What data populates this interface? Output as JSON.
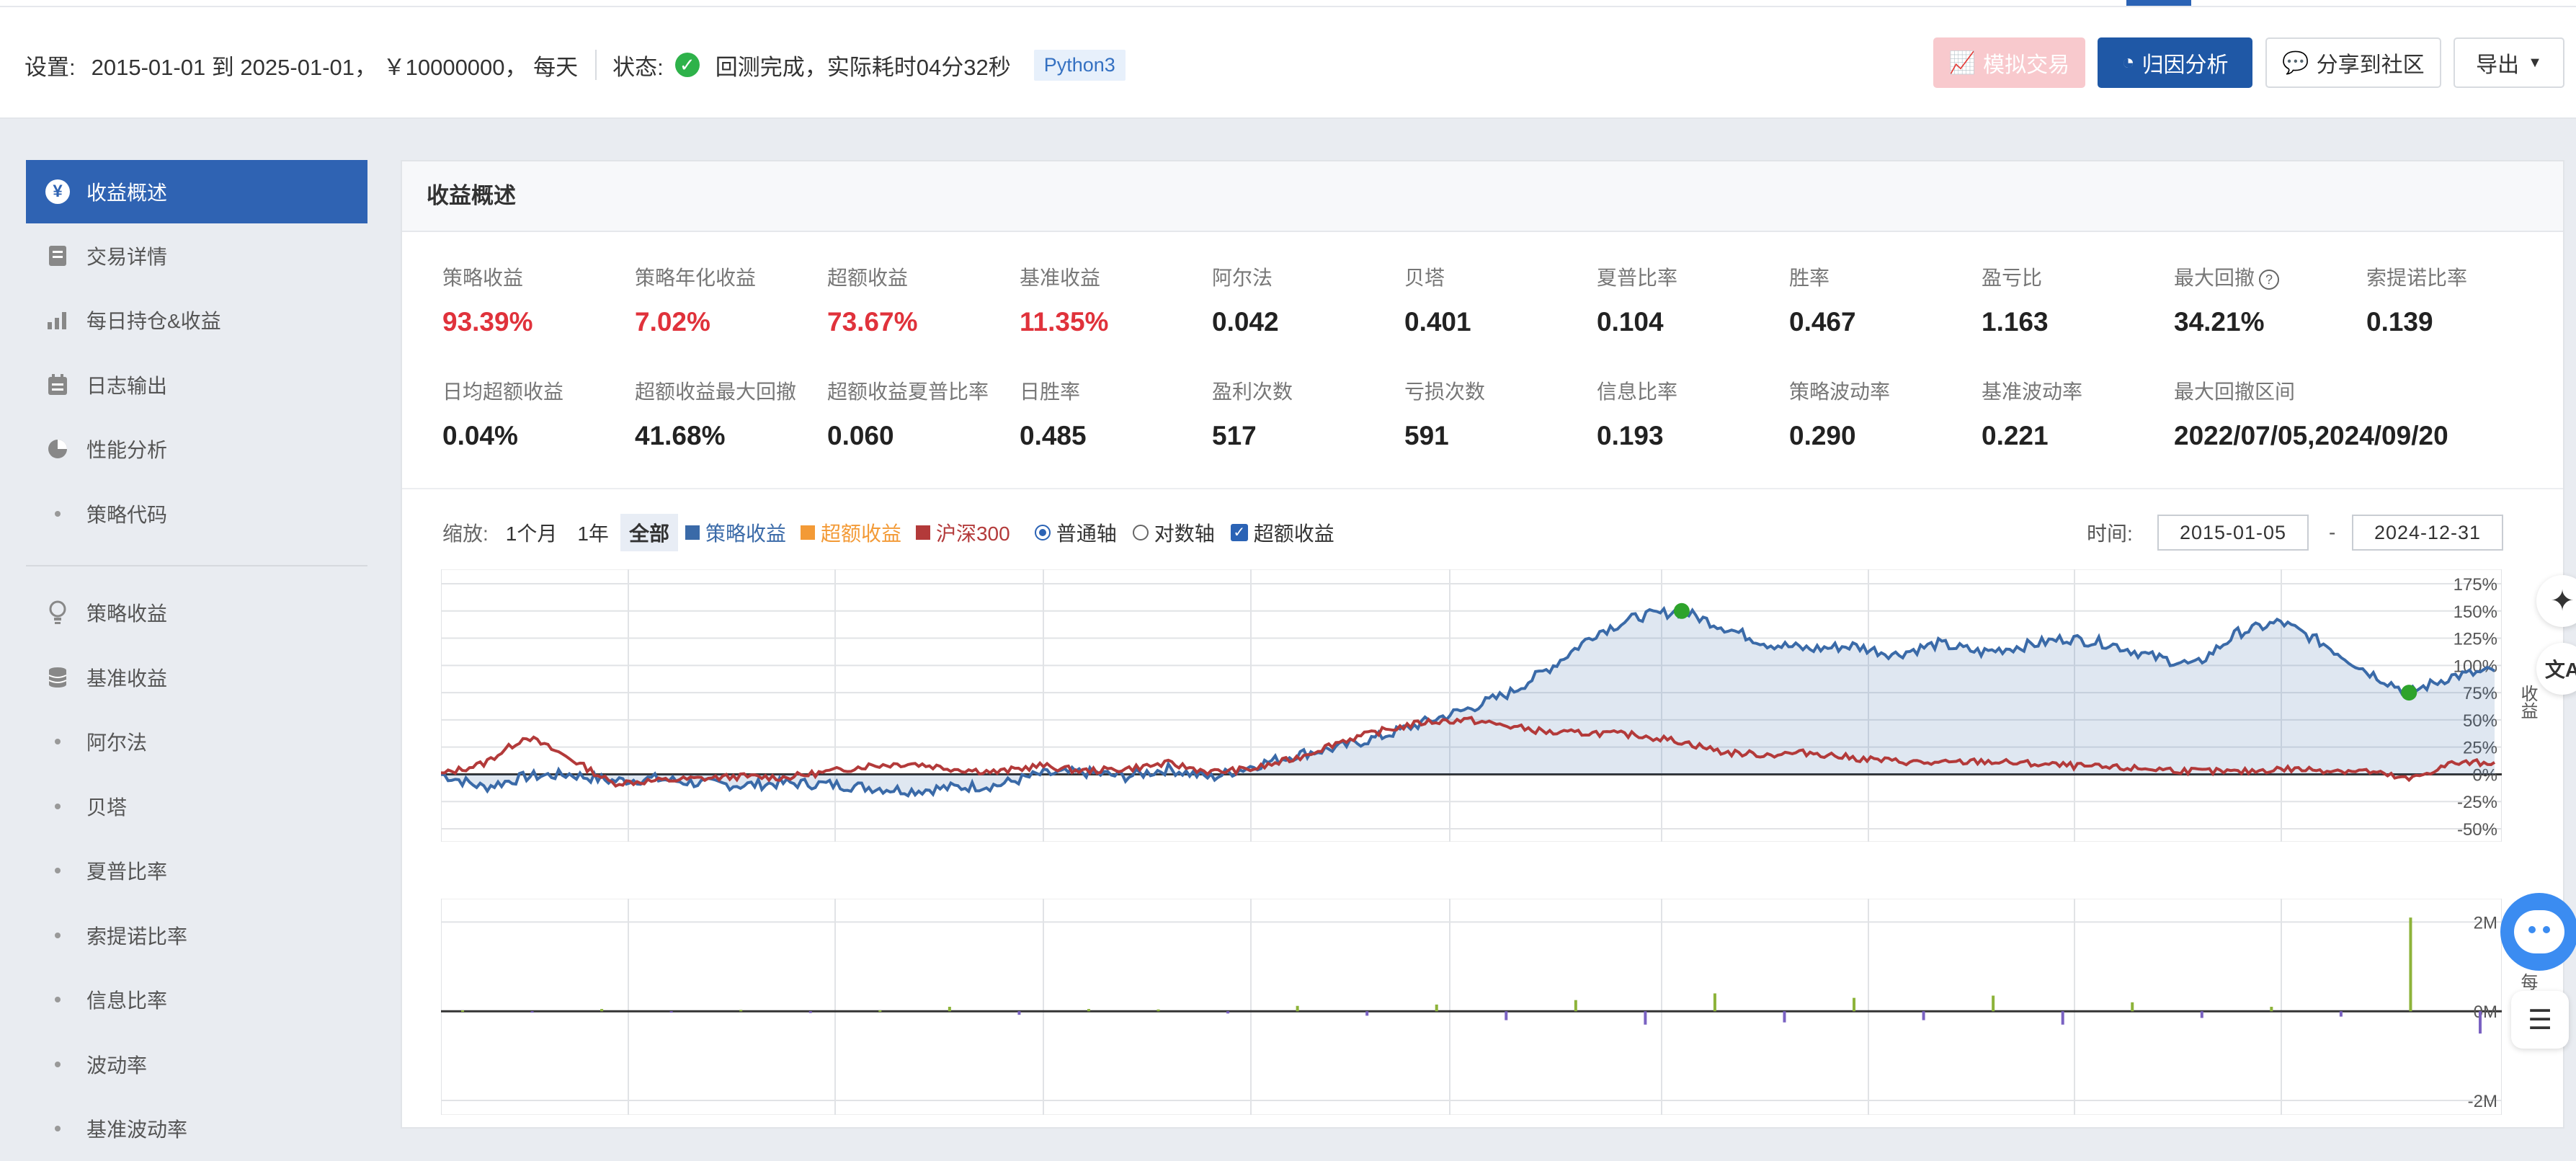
{
  "header": {
    "settings_label": "设置:",
    "settings_value": "2015-01-01 到 2025-01-01， ￥10000000， 每天",
    "status_label": "状态:",
    "status_value": "回测完成，实际耗时04分32秒",
    "language_tag": "Python3",
    "buttons": {
      "simulate": "模拟交易",
      "attribution": "归因分析",
      "share": "分享到社区",
      "export": "导出"
    }
  },
  "sidebar": {
    "items": [
      {
        "label": "收益概述",
        "icon": "yuan-icon",
        "active": true
      },
      {
        "label": "交易详情",
        "icon": "document-icon"
      },
      {
        "label": "每日持仓&收益",
        "icon": "bar-chart-icon"
      },
      {
        "label": "日志输出",
        "icon": "calendar-icon"
      },
      {
        "label": "性能分析",
        "icon": "pie-icon"
      },
      {
        "label": "策略代码",
        "icon": "dot"
      }
    ],
    "analysis_items": [
      {
        "label": "策略收益",
        "icon": "bulb-icon"
      },
      {
        "label": "基准收益",
        "icon": "database-icon"
      },
      {
        "label": "阿尔法",
        "icon": "dot"
      },
      {
        "label": "贝塔",
        "icon": "dot"
      },
      {
        "label": "夏普比率",
        "icon": "dot"
      },
      {
        "label": "索提诺比率",
        "icon": "dot"
      },
      {
        "label": "信息比率",
        "icon": "dot"
      },
      {
        "label": "波动率",
        "icon": "dot"
      },
      {
        "label": "基准波动率",
        "icon": "dot"
      }
    ]
  },
  "panel": {
    "title": "收益概述",
    "stats_row1": [
      {
        "label": "策略收益",
        "value": "93.39%",
        "red": true
      },
      {
        "label": "策略年化收益",
        "value": "7.02%",
        "red": true
      },
      {
        "label": "超额收益",
        "value": "73.67%",
        "red": true
      },
      {
        "label": "基准收益",
        "value": "11.35%",
        "red": true
      },
      {
        "label": "阿尔法",
        "value": "0.042"
      },
      {
        "label": "贝塔",
        "value": "0.401"
      },
      {
        "label": "夏普比率",
        "value": "0.104"
      },
      {
        "label": "胜率",
        "value": "0.467"
      },
      {
        "label": "盈亏比",
        "value": "1.163"
      },
      {
        "label": "最大回撤",
        "value": "34.21%"
      },
      {
        "label": "索提诺比率",
        "value": "0.139"
      }
    ],
    "stats_row2": [
      {
        "label": "日均超额收益",
        "value": "0.04%"
      },
      {
        "label": "超额收益最大回撤",
        "value": "41.68%"
      },
      {
        "label": "超额收益夏普比率",
        "value": "0.060"
      },
      {
        "label": "日胜率",
        "value": "0.485"
      },
      {
        "label": "盈利次数",
        "value": "517"
      },
      {
        "label": "亏损次数",
        "value": "591"
      },
      {
        "label": "信息比率",
        "value": "0.193"
      },
      {
        "label": "策略波动率",
        "value": "0.290"
      },
      {
        "label": "基准波动率",
        "value": "0.221"
      },
      {
        "label": "最大回撤区间",
        "value": "2022/07/05,2024/09/20"
      }
    ]
  },
  "controls": {
    "zoom_label": "缩放:",
    "zoom_options": [
      "1个月",
      "1年",
      "全部"
    ],
    "zoom_selected": "全部",
    "legend": [
      {
        "name": "策略收益",
        "color": "#3a6aa8"
      },
      {
        "name": "超额收益",
        "color": "#f39a36"
      },
      {
        "name": "沪深300",
        "color": "#b33a3a"
      }
    ],
    "axis_normal": "普通轴",
    "axis_log": "对数轴",
    "excess_check": "超额收益",
    "time_label": "时间:",
    "date_from": "2015-01-05",
    "date_to": "2024-12-31",
    "dash": "-"
  },
  "chart_data": [
    {
      "type": "area",
      "title": "",
      "x_range": [
        "2015-01-05",
        "2024-12-31"
      ],
      "ylabel": "收益",
      "y_ticks": [
        "175%",
        "150%",
        "125%",
        "100%",
        "75%",
        "50%",
        "25%",
        "0%",
        "-25%",
        "-50%"
      ],
      "ylim": [
        -50,
        175
      ],
      "series": [
        {
          "name": "策略收益",
          "color": "#3a6aa8",
          "values": [
            0,
            -12,
            -2,
            0,
            -6,
            -4,
            -8,
            -10,
            -8,
            -9,
            -12,
            -15,
            -12,
            -10,
            0,
            2,
            -2,
            5,
            -3,
            8,
            18,
            25,
            35,
            48,
            60,
            75,
            100,
            130,
            145,
            150,
            135,
            120,
            115,
            118,
            110,
            120,
            112,
            118,
            125,
            120,
            108,
            100,
            130,
            140,
            120,
            95,
            75,
            90,
            95
          ]
        },
        {
          "name": "沪深300",
          "color": "#b33a3a",
          "values": [
            0,
            10,
            35,
            15,
            -8,
            -6,
            -4,
            -2,
            -3,
            2,
            8,
            10,
            5,
            2,
            8,
            3,
            5,
            10,
            2,
            5,
            15,
            30,
            40,
            48,
            50,
            44,
            38,
            38,
            36,
            30,
            20,
            18,
            20,
            15,
            12,
            10,
            12,
            10,
            8,
            6,
            5,
            3,
            2,
            5,
            4,
            3,
            -5,
            10,
            11
          ]
        }
      ],
      "markers": [
        {
          "label": "最大回撤开始",
          "date": "2022-07-05"
        },
        {
          "label": "最大回撤结束",
          "date": "2024-09-20"
        }
      ]
    },
    {
      "type": "bar",
      "title": "",
      "ylabel": "每日",
      "y_ticks": [
        "2M",
        "0M",
        "-2M"
      ],
      "ylim": [
        -2,
        2.2
      ],
      "series": [
        {
          "name": "",
          "values": [
            0.02,
            -0.03,
            0.05,
            -0.02,
            0.03,
            -0.04,
            0.02,
            0.1,
            -0.08,
            0.05,
            0.04,
            -0.05,
            0.12,
            -0.1,
            0.15,
            -0.2,
            0.25,
            -0.3,
            0.4,
            -0.25,
            0.3,
            -0.2,
            0.35,
            -0.3,
            0.2,
            -0.15,
            0.1,
            -0.12,
            2.1,
            -0.5
          ]
        }
      ]
    }
  ],
  "floating": {
    "ai": "ai-sparkle-icon",
    "translate": "文A",
    "helper": "customer-service-icon",
    "list": "list-icon"
  }
}
